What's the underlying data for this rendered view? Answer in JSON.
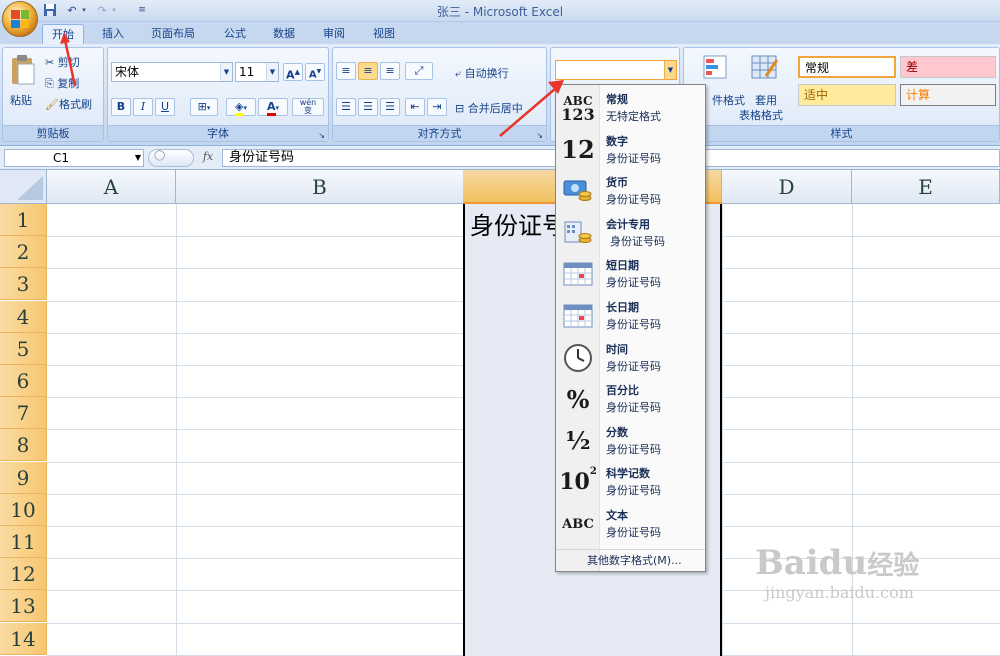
{
  "window": {
    "title": "张三 - Microsoft Excel"
  },
  "quick_access": [
    "save-icon",
    "undo-icon",
    "redo-icon",
    "customize-icon"
  ],
  "tabs": [
    {
      "label": "开始",
      "active": true
    },
    {
      "label": "插入"
    },
    {
      "label": "页面布局"
    },
    {
      "label": "公式"
    },
    {
      "label": "数据"
    },
    {
      "label": "审阅"
    },
    {
      "label": "视图"
    }
  ],
  "ribbon": {
    "clipboard": {
      "paste": "粘贴",
      "cut": "剪切",
      "copy": "复制",
      "format_painter": "格式刷",
      "label": "剪贴板"
    },
    "font": {
      "name": "宋体",
      "size": "11",
      "grow": "A",
      "shrink": "A",
      "bold": "B",
      "italic": "I",
      "underline": "U",
      "color_a": "A",
      "phonetic": "变",
      "phonetic_top": "wén",
      "label": "字体"
    },
    "alignment": {
      "wrap": "自动换行",
      "merge": "合并后居中",
      "label": "对齐方式"
    },
    "number": {
      "format_value": ""
    },
    "styles": {
      "conditional": "条件格式",
      "conditional_visible": "件格式",
      "table_format_1": "套用",
      "table_format_2": "表格格式",
      "normal": "常规",
      "bad": "差",
      "neutral": "适中",
      "calc": "计算",
      "label": "样式"
    },
    "colors": {
      "bad_bg": "#ffc7ce",
      "bad_fg": "#9c0006",
      "neutral_bg": "#ffeb9c",
      "neutral_fg": "#9c6500",
      "calc_bg": "#f2f2f2",
      "calc_fg": "#fa7d00"
    }
  },
  "formula_bar": {
    "name_box": "C1",
    "fx": "fx",
    "content": "身份证号码"
  },
  "grid": {
    "columns": [
      "A",
      "B",
      "C",
      "D",
      "E"
    ],
    "rows": [
      "1",
      "2",
      "3",
      "4",
      "5",
      "6",
      "7",
      "8",
      "9",
      "10",
      "11",
      "12",
      "13",
      "14"
    ],
    "c1_value": "身份证号码"
  },
  "number_format_menu": {
    "items": [
      {
        "title": "常规",
        "subtitle": "无特定格式",
        "icon": "general-format-icon",
        "glyph_top": "ABC",
        "glyph_bottom": "123"
      },
      {
        "title": "数字",
        "subtitle": "身份证号码",
        "icon": "number-format-icon",
        "glyph": "12"
      },
      {
        "title": "货币",
        "subtitle": "身份证号码",
        "icon": "currency-format-icon"
      },
      {
        "title": "会计专用",
        "subtitle": "身份证号码",
        "icon": "accounting-format-icon"
      },
      {
        "title": "短日期",
        "subtitle": "身份证号码",
        "icon": "short-date-icon"
      },
      {
        "title": "长日期",
        "subtitle": "身份证号码",
        "icon": "long-date-icon"
      },
      {
        "title": "时间",
        "subtitle": "身份证号码",
        "icon": "time-clock-icon"
      },
      {
        "title": "百分比",
        "subtitle": "身份证号码",
        "icon": "percent-icon",
        "glyph": "%"
      },
      {
        "title": "分数",
        "subtitle": "身份证号码",
        "icon": "fraction-icon",
        "glyph": "½"
      },
      {
        "title": "科学记数",
        "subtitle": "身份证号码",
        "icon": "scientific-icon",
        "glyph": "10",
        "glyph_sup": "2"
      },
      {
        "title": "文本",
        "subtitle": "身份证号码",
        "icon": "text-format-icon",
        "glyph": "ABC"
      }
    ],
    "more": "其他数字格式(M)..."
  },
  "watermark": {
    "brand": "Baidu",
    "brand_cn": "经验",
    "url": "jingyan.baidu.com"
  }
}
